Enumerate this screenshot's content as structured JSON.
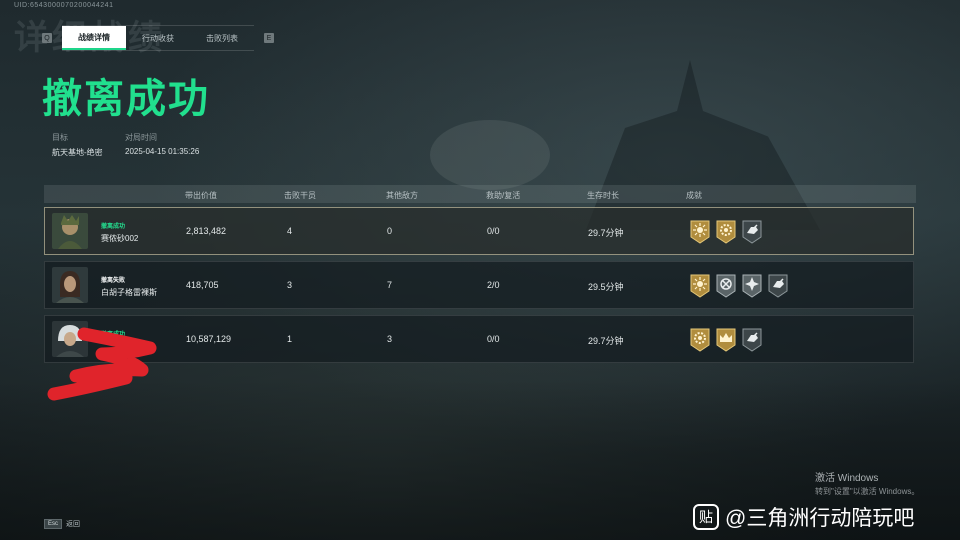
{
  "header": {
    "uid_text": "UID:6543000070200044241",
    "ghost_title": "详细战绩",
    "left_key": "Q",
    "right_key": "E",
    "tabs": [
      {
        "label": "战绩详情",
        "active": true
      },
      {
        "label": "行动收获",
        "active": false
      },
      {
        "label": "击败列表",
        "active": false
      }
    ]
  },
  "result_title": "撤离成功",
  "meta": {
    "target_label": "目标",
    "target_value": "航天基地-绝密",
    "time_label": "对局时间",
    "time_value": "2025-04-15 01:35:26"
  },
  "table": {
    "columns": [
      "带出价值",
      "击败干员",
      "其他敌方",
      "救助/复活",
      "生存时长",
      "成就"
    ],
    "rows": [
      {
        "status": "撤离成功",
        "status_type": "ok",
        "name": "赛侬砂002",
        "value": "2,813,482",
        "kills": "4",
        "other": "0",
        "rescue": "0/0",
        "survival": "29.7分钟",
        "highlight": true,
        "badges": [
          "gold-sun-badge-icon",
          "gold-gear-badge-icon",
          "silver-hand-badge-icon"
        ]
      },
      {
        "status": "撤离失败",
        "status_type": "fail",
        "name": "白胡子格雷裸斯",
        "value": "418,705",
        "kills": "3",
        "other": "7",
        "rescue": "2/0",
        "survival": "29.5分钟",
        "highlight": false,
        "badges": [
          "gold-sun-badge-icon",
          "silver-cross-badge-icon",
          "silver-star-badge-icon",
          "silver-hand-badge-icon"
        ]
      },
      {
        "status": "撤离成功",
        "status_type": "ok",
        "name": "",
        "value": "10,587,129",
        "kills": "1",
        "other": "3",
        "rescue": "0/0",
        "survival": "29.7分钟",
        "highlight": false,
        "badges": [
          "gold-gear-badge-icon",
          "gold-crown-badge-icon",
          "silver-hand-badge-icon"
        ]
      }
    ]
  },
  "footer": {
    "esc_key": "Esc",
    "back_label": "返回"
  },
  "watermark": {
    "win_line1": "激活 Windows",
    "win_line2": "转到\"设置\"以激活 Windows。",
    "tieba_logo": "贴",
    "tieba_text": "@三角洲行动陪玩吧"
  },
  "colors": {
    "accent_green": "#21e08e",
    "badge_gold": "#c9a24a",
    "badge_silver": "#8d979a"
  }
}
